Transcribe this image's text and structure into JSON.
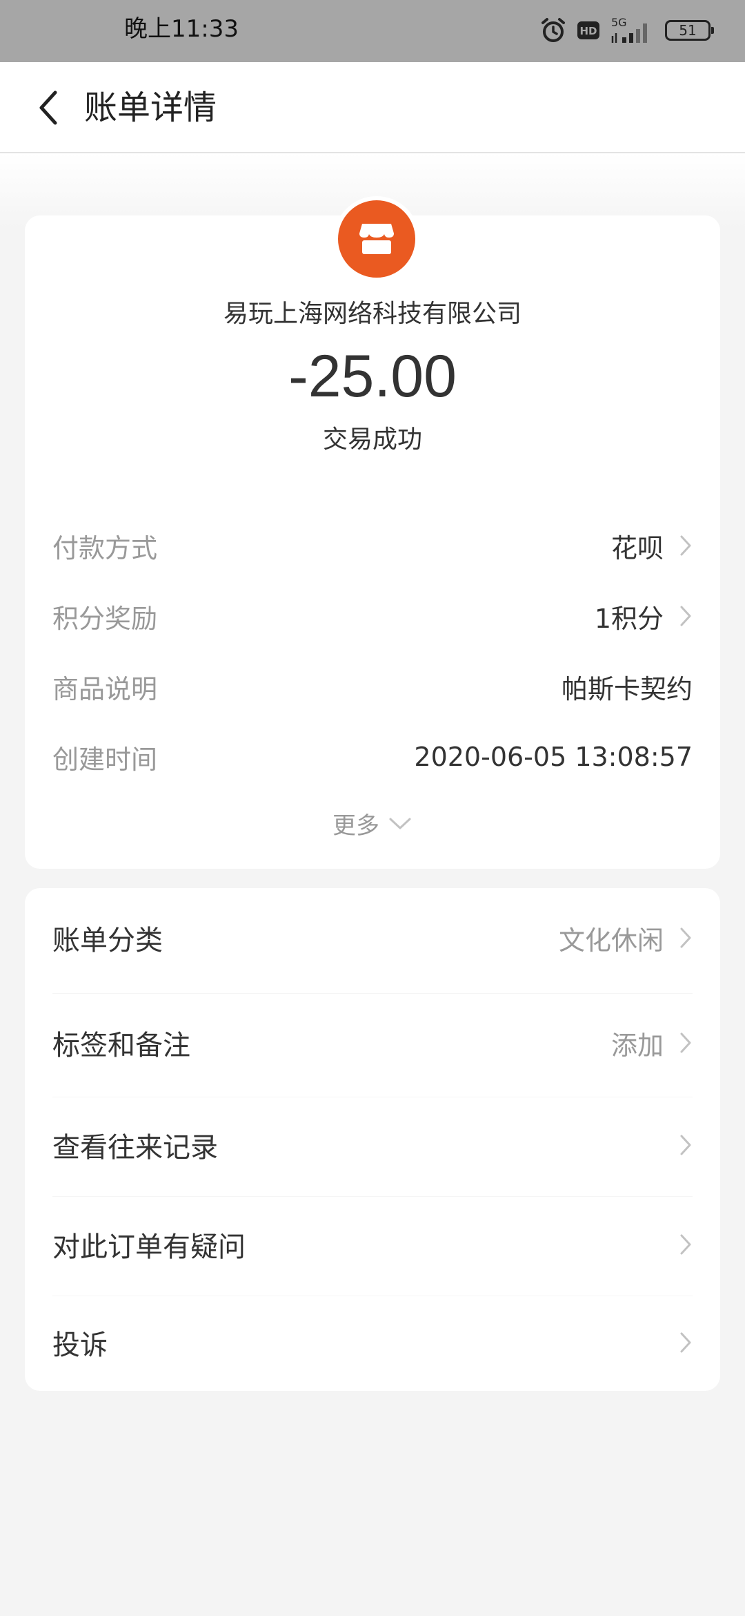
{
  "status_bar": {
    "time": "晚上11:33",
    "icons": [
      "alarm-icon",
      "hd-icon",
      "5g-signal-icon"
    ],
    "network": "5G",
    "hd": "HD",
    "battery": "51"
  },
  "nav": {
    "back_icon": "back-arrow-icon",
    "title": "账单详情"
  },
  "summary": {
    "merchant_icon": "store-icon",
    "merchant_icon_color": "#ea5a21",
    "merchant_name": "易玩上海网络科技有限公司",
    "amount": "-25.00",
    "status": "交易成功",
    "details": [
      {
        "label": "付款方式",
        "value": "花呗"
      },
      {
        "label": "积分奖励",
        "value": "1积分"
      },
      {
        "label": "商品说明",
        "value": "帕斯卡契约"
      },
      {
        "label": "创建时间",
        "value": "2020-06-05 13:08:57"
      }
    ],
    "more_label": "更多"
  },
  "menu": {
    "items": [
      {
        "label": "账单分类",
        "value": "文化休闲"
      },
      {
        "label": "标签和备注",
        "value": "添加"
      },
      {
        "label": "查看往来记录",
        "value": ""
      },
      {
        "label": "对此订单有疑问",
        "value": ""
      },
      {
        "label": "投诉",
        "value": ""
      }
    ]
  }
}
